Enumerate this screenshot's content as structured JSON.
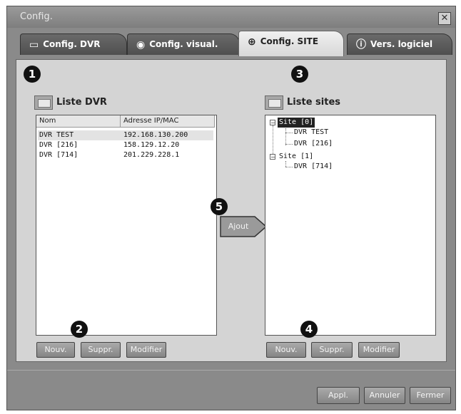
{
  "window": {
    "title": "Config.",
    "close_glyph": "✕"
  },
  "tabs": [
    {
      "label": "Config. DVR",
      "icon": "monitor-wrench-icon"
    },
    {
      "label": "Config. visual.",
      "icon": "eye-wrench-icon"
    },
    {
      "label": "Config. SITE",
      "icon": "globe-wrench-icon",
      "active": true
    },
    {
      "label": "Vers. logiciel",
      "icon": "info-icon"
    }
  ],
  "badges": {
    "b1": "1",
    "b2": "2",
    "b3": "3",
    "b4": "4",
    "b5": "5"
  },
  "dvr_list": {
    "title": "Liste DVR",
    "columns": [
      "Nom",
      "Adresse IP/MAC"
    ],
    "rows": [
      {
        "name": "DVR TEST",
        "addr": "192.168.130.200"
      },
      {
        "name": "DVR [216]",
        "addr": "158.129.12.20"
      },
      {
        "name": "DVR [714]",
        "addr": "201.229.228.1"
      }
    ],
    "buttons": {
      "new": "Nouv.",
      "delete": "Suppr.",
      "modify": "Modifier"
    }
  },
  "add_button": {
    "label": "Ajout"
  },
  "site_list": {
    "title": "Liste sites",
    "tree": {
      "site0": "Site [0]",
      "site0_children": [
        "DVR TEST",
        "DVR [216]"
      ],
      "site1": "Site [1]",
      "site1_children": [
        "DVR [714]"
      ]
    },
    "buttons": {
      "new": "Nouv.",
      "delete": "Suppr.",
      "modify": "Modifier"
    }
  },
  "footer": {
    "apply": "Appl.",
    "cancel": "Annuler",
    "close": "Fermer"
  }
}
